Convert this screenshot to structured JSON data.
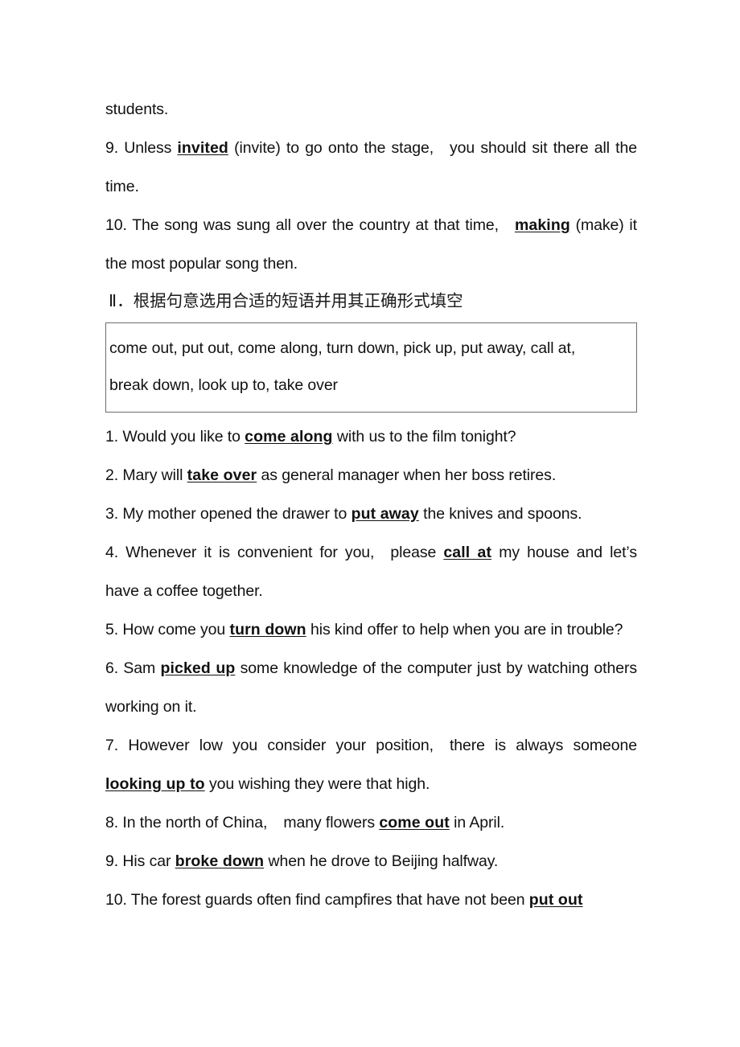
{
  "document": {
    "language": "en-zh",
    "page_background": "#ffffff",
    "text_color": "#111111",
    "box_border_color": "#6d6d6d",
    "continued_fragment": "students.",
    "section_one_tail_items": [
      {
        "number": "9.",
        "before": "Unless",
        "answer": "invited",
        "after": "(invite) to go onto the stage,",
        "after2": "you should sit there all the time."
      },
      {
        "number": "10.",
        "before": "The song was sung all over the country at that time,",
        "answer": "making",
        "after": "(make) it the most popular song then."
      }
    ],
    "section_two": {
      "heading": "Ⅱ．根据句意选用合适的短语并用其正确形式填空",
      "phrase_bank_line1": "come out, put out, come along, turn down, pick up, put away, call at,",
      "phrase_bank_line2": "break down, look up to, take over",
      "phrase_bank": [
        "come out",
        "put out",
        "come along",
        "turn down",
        "pick up",
        "put away",
        "call at",
        "break down",
        "look up to",
        "take over"
      ],
      "items": [
        {
          "number": "1.",
          "before": "Would you like to",
          "answer": "come along",
          "after": "with us to the film tonight?"
        },
        {
          "number": "2.",
          "before": "Mary will",
          "answer": "take over",
          "after": "as general manager when her boss retires."
        },
        {
          "number": "3.",
          "before": "My mother opened the drawer to",
          "answer": "put away",
          "after": "the knives and spoons."
        },
        {
          "number": "4.",
          "before": "Whenever it is convenient for you,",
          "mid": "please",
          "answer": "call at",
          "after": "my house and let’s have a coffee together."
        },
        {
          "number": "5.",
          "before": "How come you",
          "answer": "turn down",
          "after": "his kind offer to help when you are in trouble?"
        },
        {
          "number": "6.",
          "before": "Sam",
          "answer": "picked up",
          "after": "some knowledge of the computer just by watching others working on it."
        },
        {
          "number": "7.",
          "before": "However low you consider your position,",
          "mid": "there is always someone",
          "answer": "looking up to",
          "after": "you wishing they were that high."
        },
        {
          "number": "8.",
          "before": "In the north of China,",
          "mid": "many flowers",
          "answer": "come out",
          "after": "in April."
        },
        {
          "number": "9.",
          "before": "His car",
          "answer": "broke down",
          "after": "when he drove to Beijing halfway."
        },
        {
          "number": "10.",
          "before": "The forest guards often find campfires that have not been",
          "answer": "put out",
          "after": ""
        }
      ]
    }
  }
}
